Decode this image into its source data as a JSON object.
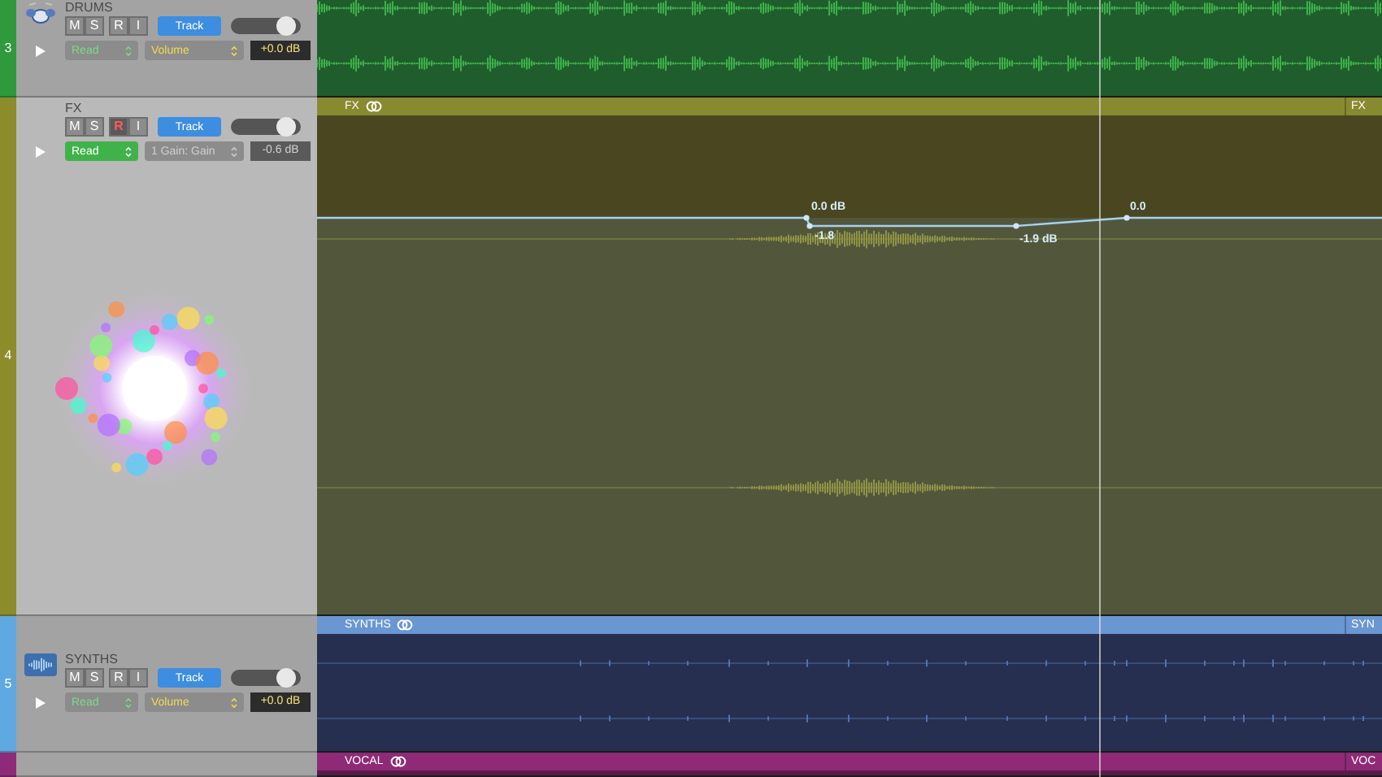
{
  "tracks": [
    {
      "number": "3",
      "kind": "drums",
      "name": "DRUMS",
      "color": "#2e9a3c",
      "selected": false,
      "buttons": [
        {
          "label": "M",
          "on": false
        },
        {
          "label": "S",
          "on": false
        },
        {
          "label": "R",
          "on": false
        },
        {
          "label": "I",
          "on": false
        }
      ],
      "track_button": "Track",
      "volume": {
        "level": 0.78
      },
      "mode": {
        "label": "Read",
        "on": false
      },
      "parameter": "Volume",
      "param_active": true,
      "value": "+0.0 dB",
      "lane": {
        "kind": "drums"
      }
    },
    {
      "number": "4",
      "kind": "fx",
      "name": "FX",
      "color": "#8c8c2a",
      "selected": true,
      "buttons": [
        {
          "label": "M",
          "on": false
        },
        {
          "label": "S",
          "on": false
        },
        {
          "label": "R",
          "on": true
        },
        {
          "label": "I",
          "on": false
        }
      ],
      "track_button": "Track",
      "volume": {
        "level": 0.78
      },
      "mode": {
        "label": "Read",
        "on": true
      },
      "parameter": "1 Gain: Gain",
      "param_active": false,
      "value": "-0.6 dB",
      "lane": {
        "kind": "fx",
        "regions": [
          {
            "name": "FX",
            "looped": true
          },
          {
            "name": "FX"
          }
        ],
        "automation": [
          {
            "label": "0.0 dB"
          },
          {
            "label": "-1.8"
          },
          {
            "label": "-1.9 dB"
          },
          {
            "label": "0.0"
          }
        ]
      }
    },
    {
      "number": "5",
      "kind": "synths",
      "name": "SYNTHS",
      "color": "#5fa8e0",
      "selected": false,
      "buttons": [
        {
          "label": "M",
          "on": false
        },
        {
          "label": "S",
          "on": false
        },
        {
          "label": "R",
          "on": false
        },
        {
          "label": "I",
          "on": false
        }
      ],
      "track_button": "Track",
      "volume": {
        "level": 0.78
      },
      "mode": {
        "label": "Read",
        "on": false
      },
      "parameter": "Volume",
      "param_active": true,
      "value": "+0.0 dB",
      "lane": {
        "kind": "synths",
        "regions": [
          {
            "name": "SYNTHS",
            "looped": true
          },
          {
            "name": "SYN"
          }
        ]
      }
    },
    {
      "color": "#8e2a78",
      "selected": false,
      "lane": {
        "kind": "vocal",
        "regions": [
          {
            "name": "VOCAL",
            "looped": true
          },
          {
            "name": "VOC"
          }
        ]
      }
    }
  ]
}
